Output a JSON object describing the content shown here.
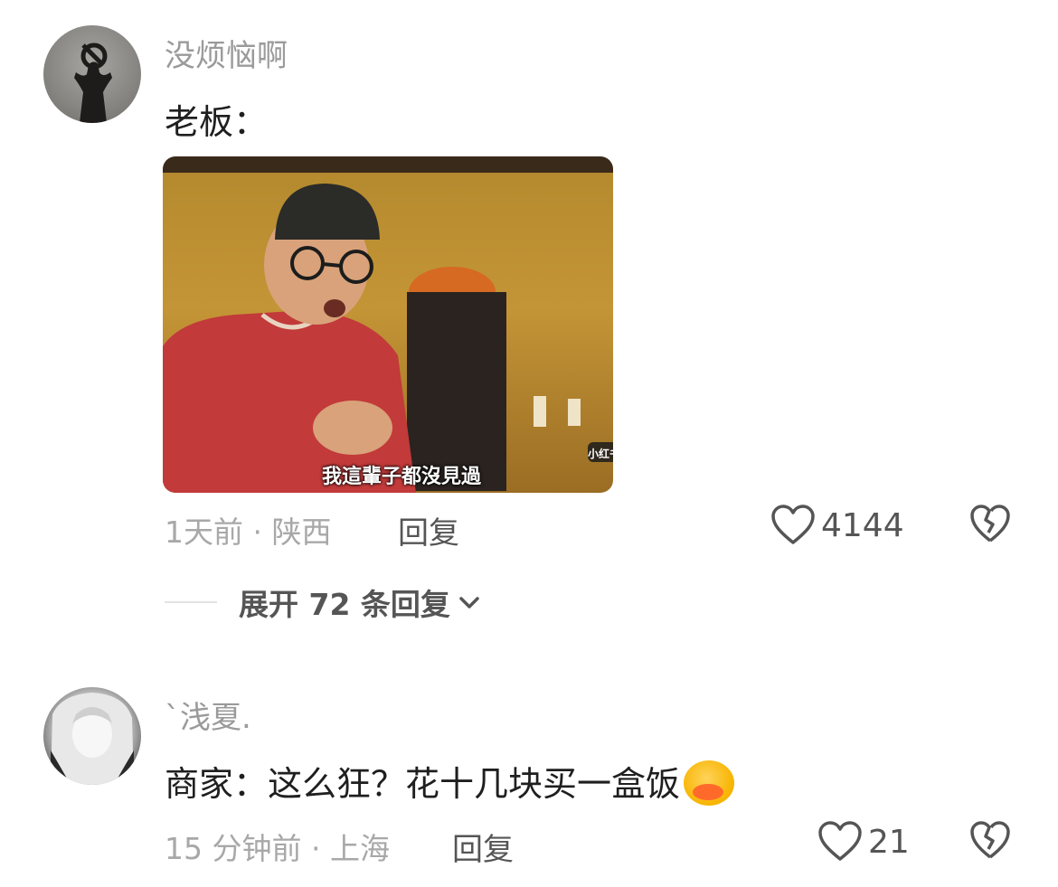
{
  "comments": [
    {
      "username": "没烦恼啊",
      "text": "老板：",
      "meme_subtitle": "我這輩子都沒見過",
      "meme_watermark": "小红书",
      "time": "1天前",
      "sep": "·",
      "location": "陕西",
      "reply_label": "回复",
      "likes": "4144",
      "expand_label": "展开 72 条回复"
    },
    {
      "username": "`浅夏.",
      "text": "商家：这么狂？花十几块买一盒饭",
      "time": "15 分钟前",
      "sep": "·",
      "location": "上海",
      "reply_label": "回复",
      "likes": "21"
    }
  ],
  "icons": {
    "like": "heart-outline-icon",
    "dislike": "broken-heart-icon",
    "expand": "chevron-down-icon",
    "emoji": "laughing-emoji-icon"
  }
}
